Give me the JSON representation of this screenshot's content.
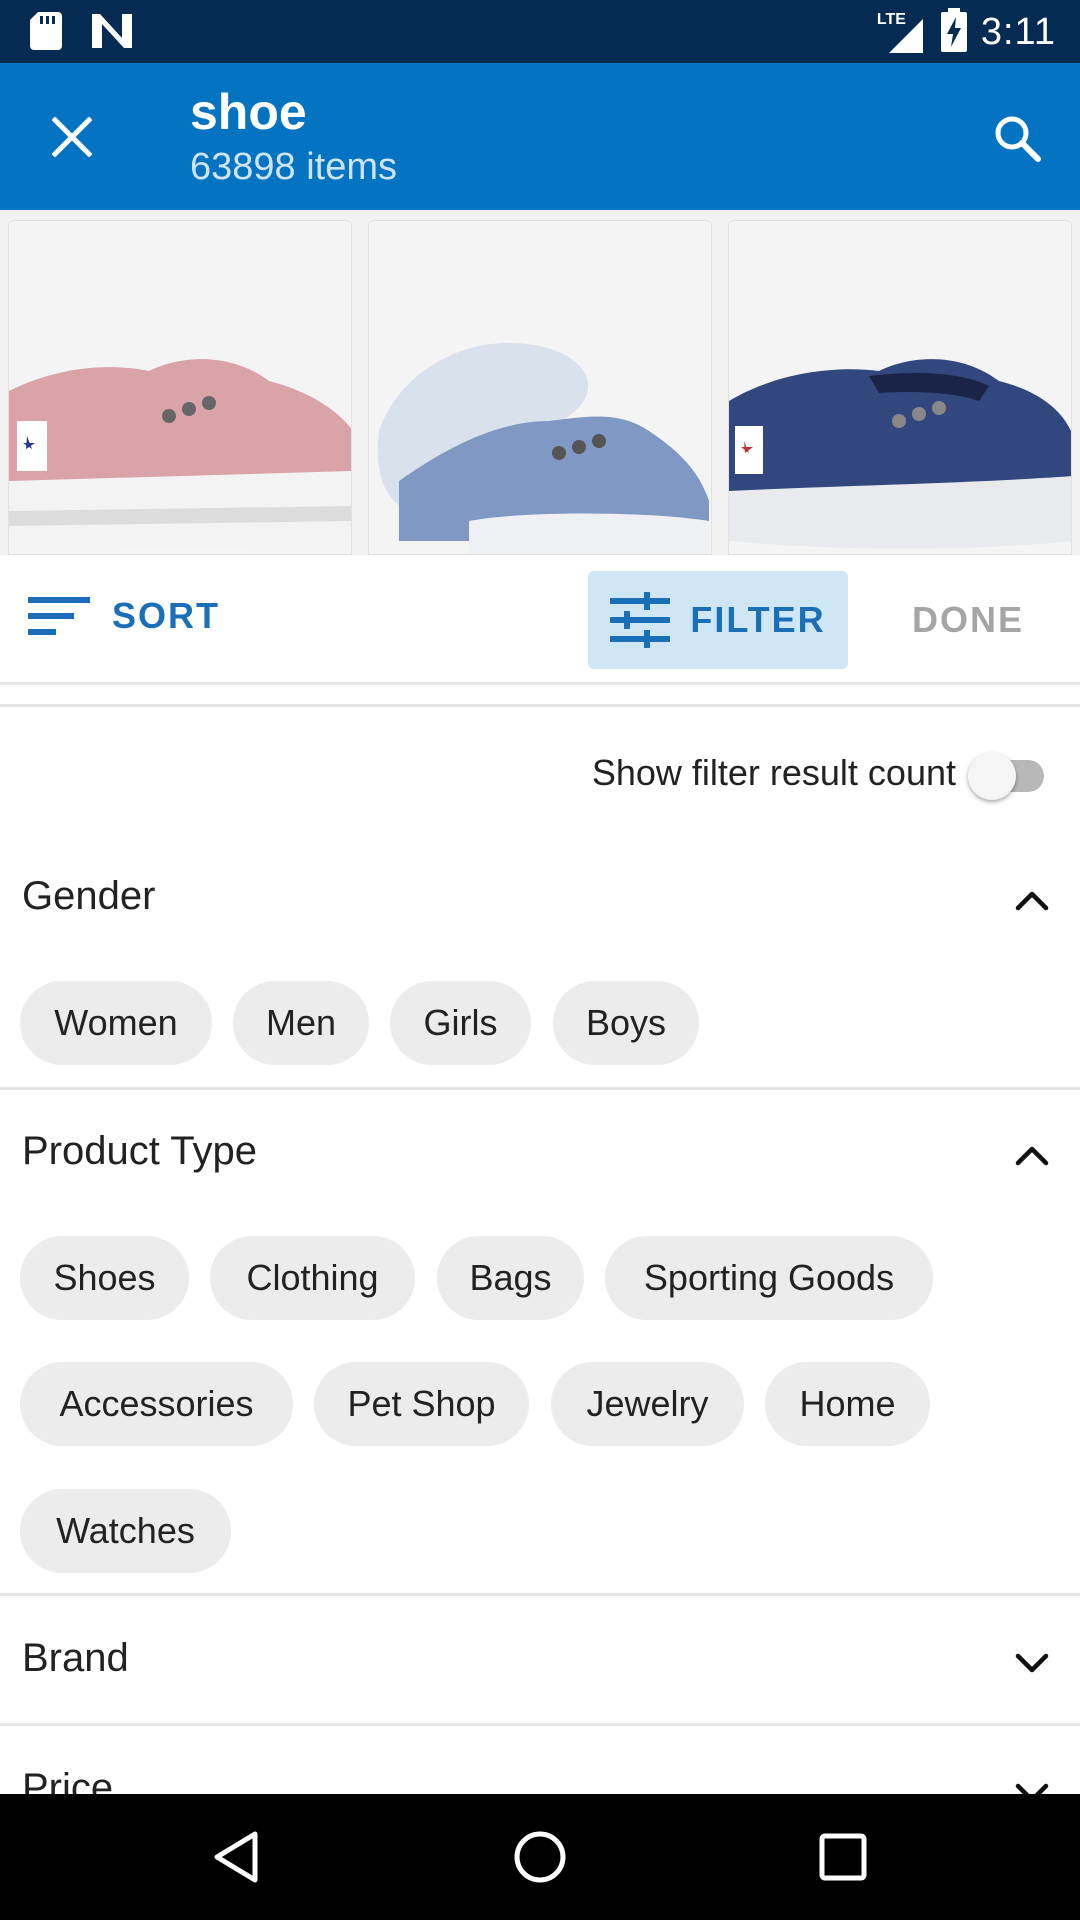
{
  "status_bar": {
    "network_label": "LTE",
    "time": "3:11"
  },
  "app_bar": {
    "title": "shoe",
    "subtitle": "63898 items"
  },
  "products": [
    {
      "name": "pink-slip-on-shoe",
      "color": "#d9a3a8"
    },
    {
      "name": "light-blue-slip-on-shoe",
      "color": "#7f99c4"
    },
    {
      "name": "navy-slip-on-shoe",
      "color": "#33477f"
    }
  ],
  "actions": {
    "sort_label": "SORT",
    "filter_label": "FILTER",
    "done_label": "DONE"
  },
  "filter_count": {
    "label": "Show filter result count",
    "enabled": false
  },
  "sections": {
    "gender": {
      "title": "Gender",
      "expanded": true,
      "options": [
        "Women",
        "Men",
        "Girls",
        "Boys"
      ]
    },
    "product_type": {
      "title": "Product Type",
      "expanded": true,
      "options": [
        "Shoes",
        "Clothing",
        "Bags",
        "Sporting Goods",
        "Accessories",
        "Pet Shop",
        "Jewelry",
        "Home",
        "Watches"
      ]
    },
    "brand": {
      "title": "Brand",
      "expanded": false
    },
    "price": {
      "title": "Price",
      "expanded": false
    }
  },
  "colors": {
    "status_bar": "#062b52",
    "app_bar": "#0373c2",
    "accent": "#1a6fb8",
    "filter_active_bg": "#cfe6f5",
    "chip_bg": "#ececec"
  }
}
